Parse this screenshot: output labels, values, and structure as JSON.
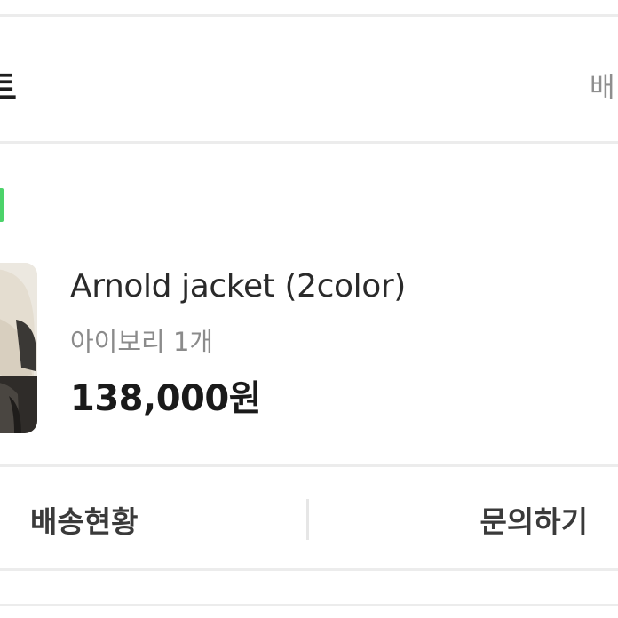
{
  "header": {
    "title": "트",
    "right_link": "배"
  },
  "order": {
    "status_color": "#4cd36a",
    "product": {
      "name": "Arnold jacket (2color)",
      "option": "아이보리 1개",
      "price": "138,000원"
    }
  },
  "actions": {
    "track_label": "배송현황",
    "inquiry_label": "문의하기"
  }
}
